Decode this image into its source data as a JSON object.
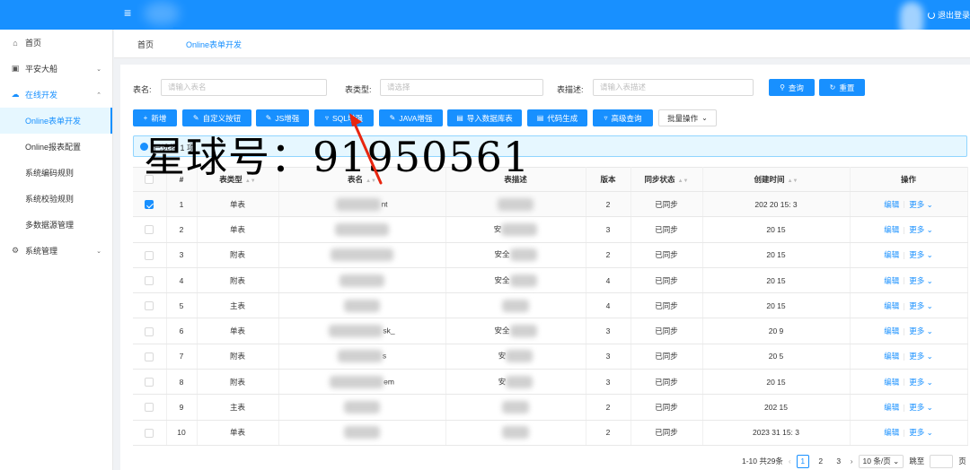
{
  "header": {
    "menu_icon": "menu-fold-icon",
    "logout_label": "退出登录"
  },
  "sidebar": {
    "items": [
      {
        "label": "首页",
        "icon": "home-icon"
      },
      {
        "label": "平安大船",
        "icon": "monitor-icon",
        "expandable": true
      },
      {
        "label": "在线开发",
        "icon": "cloud-icon",
        "expandable": true,
        "open": true
      },
      {
        "label": "Online表单开发",
        "sub": true,
        "active": true
      },
      {
        "label": "Online报表配置",
        "sub": true
      },
      {
        "label": "系统编码规则",
        "sub": true
      },
      {
        "label": "系统校验规则",
        "sub": true
      },
      {
        "label": "多数据源管理",
        "sub": true
      },
      {
        "label": "系统管理",
        "icon": "setting-icon",
        "expandable": true
      }
    ]
  },
  "tabs": [
    {
      "label": "首页"
    },
    {
      "label": "Online表单开发",
      "active": true
    }
  ],
  "search": {
    "table_name_label": "表名:",
    "table_name_placeholder": "请输入表名",
    "table_type_label": "表类型:",
    "table_type_placeholder": "请选择",
    "table_desc_label": "表描述:",
    "table_desc_placeholder": "请输入表描述",
    "query_label": "查询",
    "reset_label": "重置"
  },
  "toolbar": {
    "add_label": "新增",
    "custom_button_label": "自定义按钮",
    "js_label": "JS增强",
    "sql_label": "SQL增强",
    "java_label": "JAVA增强",
    "import_label": "导入数据库表",
    "codegen_label": "代码生成",
    "advanced_query_label": "高级查询",
    "batch_label": "批量操作"
  },
  "alert": {
    "text": "已选择 1 项"
  },
  "watermark": "星球号：91950561",
  "table": {
    "columns": [
      "#",
      "表类型",
      "表名",
      "表描述",
      "版本",
      "同步状态",
      "创建时间",
      "操作"
    ],
    "edit_label": "编辑",
    "more_label": "更多",
    "rows": [
      {
        "no": "1",
        "type": "单表",
        "name": "nt",
        "desc": "",
        "version": "2",
        "status": "已同步",
        "created": "202   20 15:  3",
        "checked": true
      },
      {
        "no": "2",
        "type": "单表",
        "name": "",
        "desc": "安",
        "version": "3",
        "status": "已同步",
        "created": "20    15",
        "checked": false
      },
      {
        "no": "3",
        "type": "附表",
        "name": "",
        "desc": "安全",
        "version": "2",
        "status": "已同步",
        "created": "20    15",
        "checked": false
      },
      {
        "no": "4",
        "type": "附表",
        "name": "",
        "desc": "安全",
        "version": "4",
        "status": "已同步",
        "created": "20    15",
        "checked": false
      },
      {
        "no": "5",
        "type": "主表",
        "name": "",
        "desc": "",
        "version": "4",
        "status": "已同步",
        "created": "20    15",
        "checked": false
      },
      {
        "no": "6",
        "type": "单表",
        "name": "sk_",
        "desc": "安全",
        "version": "3",
        "status": "已同步",
        "created": "20    9",
        "checked": false
      },
      {
        "no": "7",
        "type": "附表",
        "name": "s",
        "desc": "安",
        "version": "3",
        "status": "已同步",
        "created": "20    5",
        "checked": false
      },
      {
        "no": "8",
        "type": "附表",
        "name": "em",
        "desc": "安",
        "version": "3",
        "status": "已同步",
        "created": "20    15",
        "checked": false
      },
      {
        "no": "9",
        "type": "主表",
        "name": "",
        "desc": "",
        "version": "2",
        "status": "已同步",
        "created": "202    15",
        "checked": false
      },
      {
        "no": "10",
        "type": "单表",
        "name": "",
        "desc": "",
        "version": "2",
        "status": "已同步",
        "created": "2023  31 15:  3",
        "checked": false
      }
    ]
  },
  "pagination": {
    "total_text": "1-10 共29条",
    "pages": [
      "1",
      "2",
      "3"
    ],
    "current": "1",
    "page_size": "10 条/页",
    "jump_label": "跳至",
    "page_unit": "页"
  }
}
